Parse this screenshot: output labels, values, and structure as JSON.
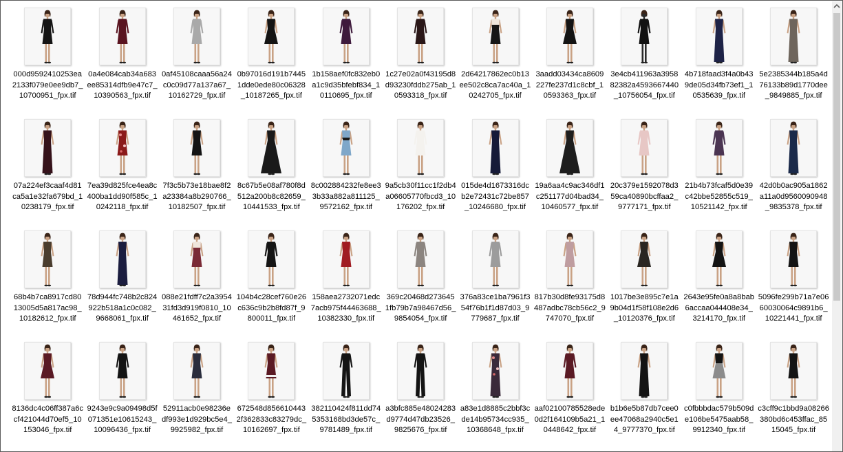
{
  "files": [
    {
      "name": "000d9592410253ea2133f079e0ee9db7_10700951_fpx.tif",
      "dress": "#151515",
      "skin": "#c9a285",
      "style": "bodycon-cutout"
    },
    {
      "name": "0a4e084cab34a683ee85314dfb9e47c7_10390563_fpx.tif",
      "dress": "#5a1420",
      "skin": "#c9a285",
      "style": "bell-sleeve"
    },
    {
      "name": "0af45108caaa56a24c0c09d77a137a67_10162729_fpx.tif",
      "dress": "#a9a9a9",
      "skin": "#c9a285",
      "style": "sheath"
    },
    {
      "name": "0b97016d191b74451dde0ede80c06328_10187265_fpx.tif",
      "dress": "#141414",
      "skin": "#c9a285",
      "style": "flounce"
    },
    {
      "name": "1b158aef0fc832eb0a1c9d35bfebf834_10110695_fpx.tif",
      "dress": "#3e1a3c",
      "skin": "#c9a285",
      "style": "sheath"
    },
    {
      "name": "1c27e02a0f43195d8d93230fddb275ab_10593318_fpx.tif",
      "dress": "#2a1718",
      "skin": "#c9a285",
      "style": "sheath"
    },
    {
      "name": "2d64217862ec0b13ee502c8ca7ac40a_10242705_fpx.tif",
      "dress": "#161616",
      "skin": "#c9a285",
      "style": "colorblock"
    },
    {
      "name": "3aadd03434ca8609227fe237d1c8cbf_10593363_fpx.tif",
      "dress": "#141414",
      "skin": "#c9a285",
      "style": "fit-flare"
    },
    {
      "name": "3e4cb411963a395882382a4593667440_10756054_fpx.tif",
      "dress": "#121212",
      "skin": "#2a2a2a",
      "style": "sweater"
    },
    {
      "name": "4b718faad3f4a0b439de05d34fb73ef1_10535639_fpx.tif",
      "dress": "#1e2347",
      "skin": "#c9a285",
      "style": "gown"
    },
    {
      "name": "5e2385344b185a4d76133b89d1770dee_9849885_fpx.tif",
      "dress": "#6e655c",
      "skin": "#c9a285",
      "style": "gown"
    },
    {
      "name": "07a224ef3caaf4d81ca5a1e32fa679bd_10238179_fpx.tif",
      "dress": "#35121a",
      "skin": "#c9a285",
      "style": "gown"
    },
    {
      "name": "7ea39d825fce4ea8c400ba1dd90f585c_10242118_fpx.tif",
      "dress": "#8b1a1a",
      "skin": "#c9a285",
      "style": "floral"
    },
    {
      "name": "7f3c5b73e18bae8f2a23384a8b290766_10182507_fpx.tif",
      "dress": "#141414",
      "skin": "#c9a285",
      "style": "off-shoulder"
    },
    {
      "name": "8c67b5e08af780f8d512a200b8c82659_10441533_fpx.tif",
      "dress": "#1a1a1a",
      "skin": "#c9a285",
      "style": "ballgown"
    },
    {
      "name": "8c002884232fe8ee33b33a882a811125_9572162_fpx.tif",
      "dress": "#7fa7c9",
      "skin": "#c9a285",
      "style": "halter"
    },
    {
      "name": "9a5cb30f11cc1f2db4a06605770fbcd3_10176202_fpx.tif",
      "dress": "#f4f2ee",
      "skin": "#c9a285",
      "style": "sweater"
    },
    {
      "name": "015de4d1673316dcb2e72431c72be857_10246680_fpx.tif",
      "dress": "#161a38",
      "skin": "#c9a285",
      "style": "gown"
    },
    {
      "name": "19a6aa4c9ac346df1c251177d04bad34_10460577_fpx.tif",
      "dress": "#1e1e1e",
      "skin": "#c9a285",
      "style": "ballgown"
    },
    {
      "name": "20c379e1592078d359ca40890bcffaa2_9777171_fpx.tif",
      "dress": "#e7c7c5",
      "skin": "#c9a285",
      "style": "sheath"
    },
    {
      "name": "21b4b73fcaf5d0e39c42bbe52855c519_10521142_fpx.tif",
      "dress": "#4b3552",
      "skin": "#c9a285",
      "style": "long-sleeve"
    },
    {
      "name": "42d0b0ac905a1862a11a0d9560090948_9835378_fpx.tif",
      "dress": "#1b2a4a",
      "skin": "#c9a285",
      "style": "gown"
    },
    {
      "name": "68b4b7ca8917cd8013005d5a817ac98_10182612_fpx.tif",
      "dress": "#4a3d2e",
      "skin": "#c9a285",
      "style": "lace"
    },
    {
      "name": "78d944fc748b2c824922b518a1c0c082_9668061_fpx.tif",
      "dress": "#1b1d3f",
      "skin": "#c9a285",
      "style": "gown"
    },
    {
      "name": "088e21fdff7c2a395431fd3d919f0810_10461652_fpx.tif",
      "dress": "#7a2a36",
      "skin": "#c9a285",
      "style": "colorblock"
    },
    {
      "name": "104b4c28cef760e26c636c9b2b8fd87f_9800011_fpx.tif",
      "dress": "#151515",
      "skin": "#c9a285",
      "style": "bell-sleeve"
    },
    {
      "name": "158aea2732071edc7acb975f44463688_10382330_fpx.tif",
      "dress": "#a01c22",
      "skin": "#c9a285",
      "style": "lace"
    },
    {
      "name": "369c20468d2736451fb79b7a98467d56_9854054_fpx.tif",
      "dress": "#8c8580",
      "skin": "#c9a285",
      "style": "sheath"
    },
    {
      "name": "376a83ce1ba7961f354f76b1f1d87d03_9779687_fpx.tif",
      "dress": "#9c9c9c",
      "skin": "#c9a285",
      "style": "sheath"
    },
    {
      "name": "817b30d8fe93175d8487adbc78cb56c2_9747070_fpx.tif",
      "dress": "#bf9da0",
      "skin": "#c9a285",
      "style": "lace"
    },
    {
      "name": "1017be3e895c7e1a9b04d1f58f108e2d6_10120376_fpx.tif",
      "dress": "#2a2622",
      "skin": "#c9a285",
      "style": "fit-flare"
    },
    {
      "name": "2643e95fe0a8a8bab6accaa044408e34_3214170_fpx.tif",
      "dress": "#141414",
      "skin": "#c9a285",
      "style": "flounce"
    },
    {
      "name": "5096fe299b71a7e0660030064c9891b6_10221441_fpx.tif",
      "dress": "#141414",
      "skin": "#c9a285",
      "style": "lace"
    },
    {
      "name": "8136dc4c06ff387a6ccf421044d70ef5_10153046_fpx.tif",
      "dress": "#5a1a24",
      "skin": "#c9a285",
      "style": "fit-flare"
    },
    {
      "name": "9243e9c9a09498d5f071351e10615243_10096436_fpx.tif",
      "dress": "#141414",
      "skin": "#c9a285",
      "style": "bell-sleeve"
    },
    {
      "name": "52911acb0e98236edf993e1d929bc5e4_9925982_fpx.tif",
      "dress": "#2a2d3d",
      "skin": "#c9a285",
      "style": "sequin"
    },
    {
      "name": "672548d8566104432f362833c83279dc_10162697_fpx.tif",
      "dress": "#5a1a24",
      "skin": "#c9a285",
      "style": "striped-hem"
    },
    {
      "name": "382110424f811dd745353168bd3de57c_9781489_fpx.tif",
      "dress": "#141414",
      "skin": "#c9a285",
      "style": "jumpsuit"
    },
    {
      "name": "a3bfc885e48024283d9774d47db23526_9825676_fpx.tif",
      "dress": "#141414",
      "skin": "#c9a285",
      "style": "jumpsuit"
    },
    {
      "name": "a83e1d8885c2bbf3cde14b95734cc935_10368648_fpx.tif",
      "dress": "#3a2a3a",
      "skin": "#c9a285",
      "style": "floral-maxi"
    },
    {
      "name": "aaf02100785528ede0d2f164109b5a21_10448642_fpx.tif",
      "dress": "#5a1a24",
      "skin": "#c9a285",
      "style": "sheath"
    },
    {
      "name": "b1b6e5b87db7cee0ee47068a2940c5e14_9777370_fpx.tif",
      "dress": "#141414",
      "skin": "#c9a285",
      "style": "gown"
    },
    {
      "name": "c0fbbbdac579b509de106be5475aab58_9912340_fpx.tif",
      "dress": "#141414",
      "skin": "#c9a285",
      "style": "skirt-silver"
    },
    {
      "name": "c3cff9c1bbd9a08266380bd6c453ffac_8515045_fpx.tif",
      "dress": "#141414",
      "skin": "#c9a285",
      "style": "lace"
    }
  ],
  "colors": {
    "border": "#5a5a5a",
    "scrollbar_track": "#f0f0f0",
    "scrollbar_thumb": "#c9c9c9"
  }
}
